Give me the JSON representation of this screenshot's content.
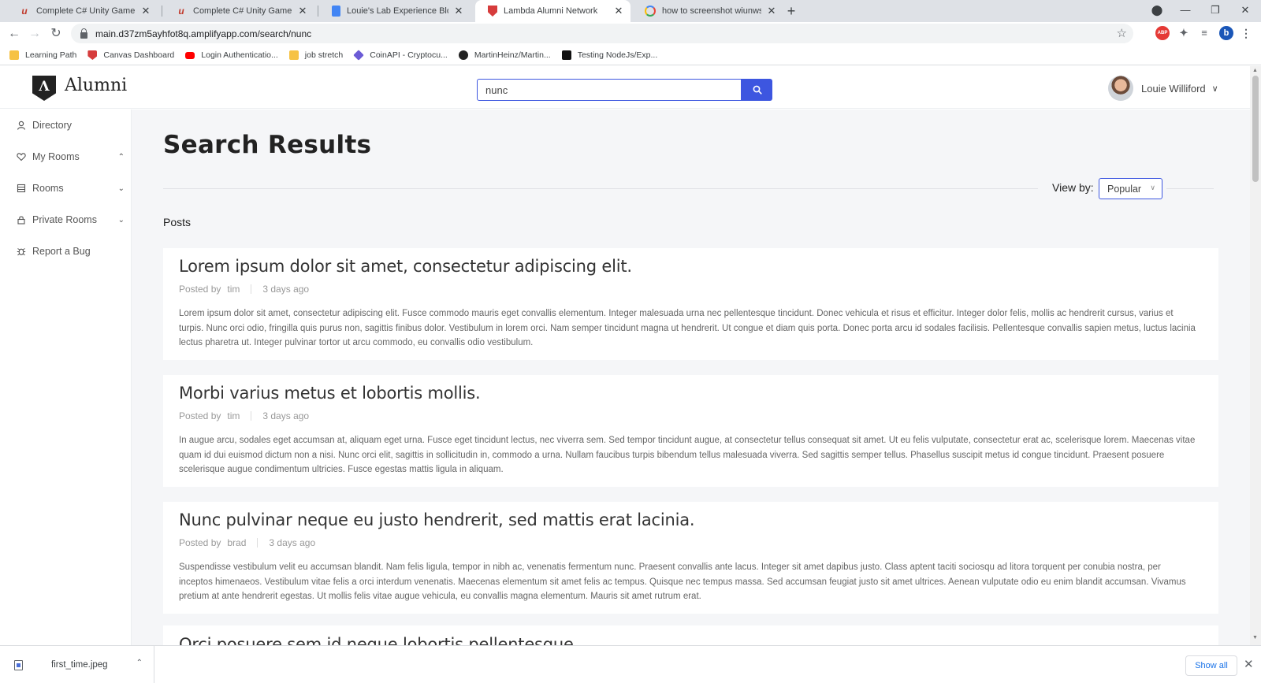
{
  "browser": {
    "tabs": [
      {
        "title": "Complete C# Unity Game Develo",
        "icon": "udemy-icon",
        "active": false
      },
      {
        "title": "Complete C# Unity Game Develo",
        "icon": "udemy-icon",
        "active": false
      },
      {
        "title": "Louie's Lab Experience Blog Post",
        "icon": "google-docs-icon",
        "active": false
      },
      {
        "title": "Lambda Alumni Network",
        "icon": "lambda-shield-icon",
        "active": true
      },
      {
        "title": "how to screenshot wiunws only",
        "icon": "google-icon",
        "active": false
      }
    ],
    "new_tab_label": "+",
    "url": "main.d37zm5ayhfot8q.amplifyapp.com/search/nunc",
    "extensions": [
      "ABP",
      "puzzle-icon",
      "playlist-icon",
      "b"
    ],
    "bookmarks": [
      {
        "label": "Learning Path",
        "icon": "folder-icon",
        "color": "#f6c244"
      },
      {
        "label": "Canvas Dashboard",
        "icon": "lambda-shield-icon",
        "color": "#d63c3c"
      },
      {
        "label": "Login Authenticatio...",
        "icon": "youtube-icon",
        "color": "#ff0000"
      },
      {
        "label": "job stretch",
        "icon": "folder-icon",
        "color": "#f6c244"
      },
      {
        "label": "CoinAPI - Cryptocu...",
        "icon": "layers-icon",
        "color": "#6b5bd6"
      },
      {
        "label": "MartinHeinz/Martin...",
        "icon": "github-icon",
        "color": "#222222"
      },
      {
        "label": "Testing NodeJs/Exp...",
        "icon": "dev-icon",
        "color": "#111111"
      }
    ]
  },
  "app": {
    "logo_text": "Alumni",
    "logo_letter": "Λ",
    "search": {
      "value": "nunc",
      "placeholder": ""
    },
    "user": {
      "name": "Louie Williford"
    },
    "sidebar": [
      {
        "label": "Directory",
        "icon": "user-icon",
        "chevron": ""
      },
      {
        "label": "My Rooms",
        "icon": "heart-icon",
        "chevron": "up"
      },
      {
        "label": "Rooms",
        "icon": "rooms-icon",
        "chevron": "down"
      },
      {
        "label": "Private Rooms",
        "icon": "lock-icon",
        "chevron": "down"
      },
      {
        "label": "Report a Bug",
        "icon": "bug-icon",
        "chevron": ""
      }
    ],
    "page_title": "Search Results",
    "view_by_label": "View by:",
    "view_by_value": "Popular",
    "section_label": "Posts",
    "posted_by_label": "Posted by",
    "posts": [
      {
        "title": "Lorem ipsum dolor sit amet, consectetur adipiscing elit.",
        "author": "tim",
        "time": "3 days ago",
        "body": "Lorem ipsum dolor sit amet, consectetur adipiscing elit. Fusce commodo mauris eget convallis elementum. Integer malesuada urna nec pellentesque tincidunt. Donec vehicula et risus et efficitur. Integer dolor felis, mollis ac hendrerit cursus, varius et turpis. Nunc orci odio, fringilla quis purus non, sagittis finibus dolor. Vestibulum in lorem orci. Nam semper tincidunt magna ut hendrerit. Ut congue et diam quis porta. Donec porta arcu id sodales facilisis. Pellentesque convallis sapien metus, luctus lacinia lectus pharetra ut. Integer pulvinar tortor ut arcu commodo, eu convallis odio vestibulum."
      },
      {
        "title": "Morbi varius metus et lobortis mollis.",
        "author": "tim",
        "time": "3 days ago",
        "body": "In augue arcu, sodales eget accumsan at, aliquam eget urna. Fusce eget tincidunt lectus, nec viverra sem. Sed tempor tincidunt augue, at consectetur tellus consequat sit amet. Ut eu felis vulputate, consectetur erat ac, scelerisque lorem. Maecenas vitae quam id dui euismod dictum non a nisi. Nunc orci elit, sagittis in sollicitudin in, commodo a urna. Nullam faucibus turpis bibendum tellus malesuada viverra. Sed sagittis semper tellus. Phasellus suscipit metus id congue tincidunt. Praesent posuere scelerisque augue condimentum ultricies. Fusce egestas mattis ligula in aliquam."
      },
      {
        "title": "Nunc pulvinar neque eu justo hendrerit, sed mattis erat lacinia.",
        "author": "brad",
        "time": "3 days ago",
        "body": "Suspendisse vestibulum velit eu accumsan blandit. Nam felis ligula, tempor in nibh ac, venenatis fermentum nunc. Praesent convallis ante lacus. Integer sit amet dapibus justo. Class aptent taciti sociosqu ad litora torquent per conubia nostra, per inceptos himenaeos. Vestibulum vitae felis a orci interdum venenatis. Maecenas elementum sit amet felis ac tempus. Quisque nec tempus massa. Sed accumsan feugiat justo sit amet ultrices. Aenean vulputate odio eu enim blandit accumsan. Vivamus pretium at ante hendrerit egestas. Ut mollis felis vitae augue vehicula, eu convallis magna elementum. Mauris sit amet rutrum erat."
      }
    ],
    "partial_post_title": "Orci posuere sem id neque lobortis pellentesque."
  },
  "downloads": {
    "file_name": "first_time.jpeg",
    "show_all_label": "Show all"
  },
  "colors": {
    "accent": "#3d56e0",
    "background": "#f5f6f8"
  }
}
